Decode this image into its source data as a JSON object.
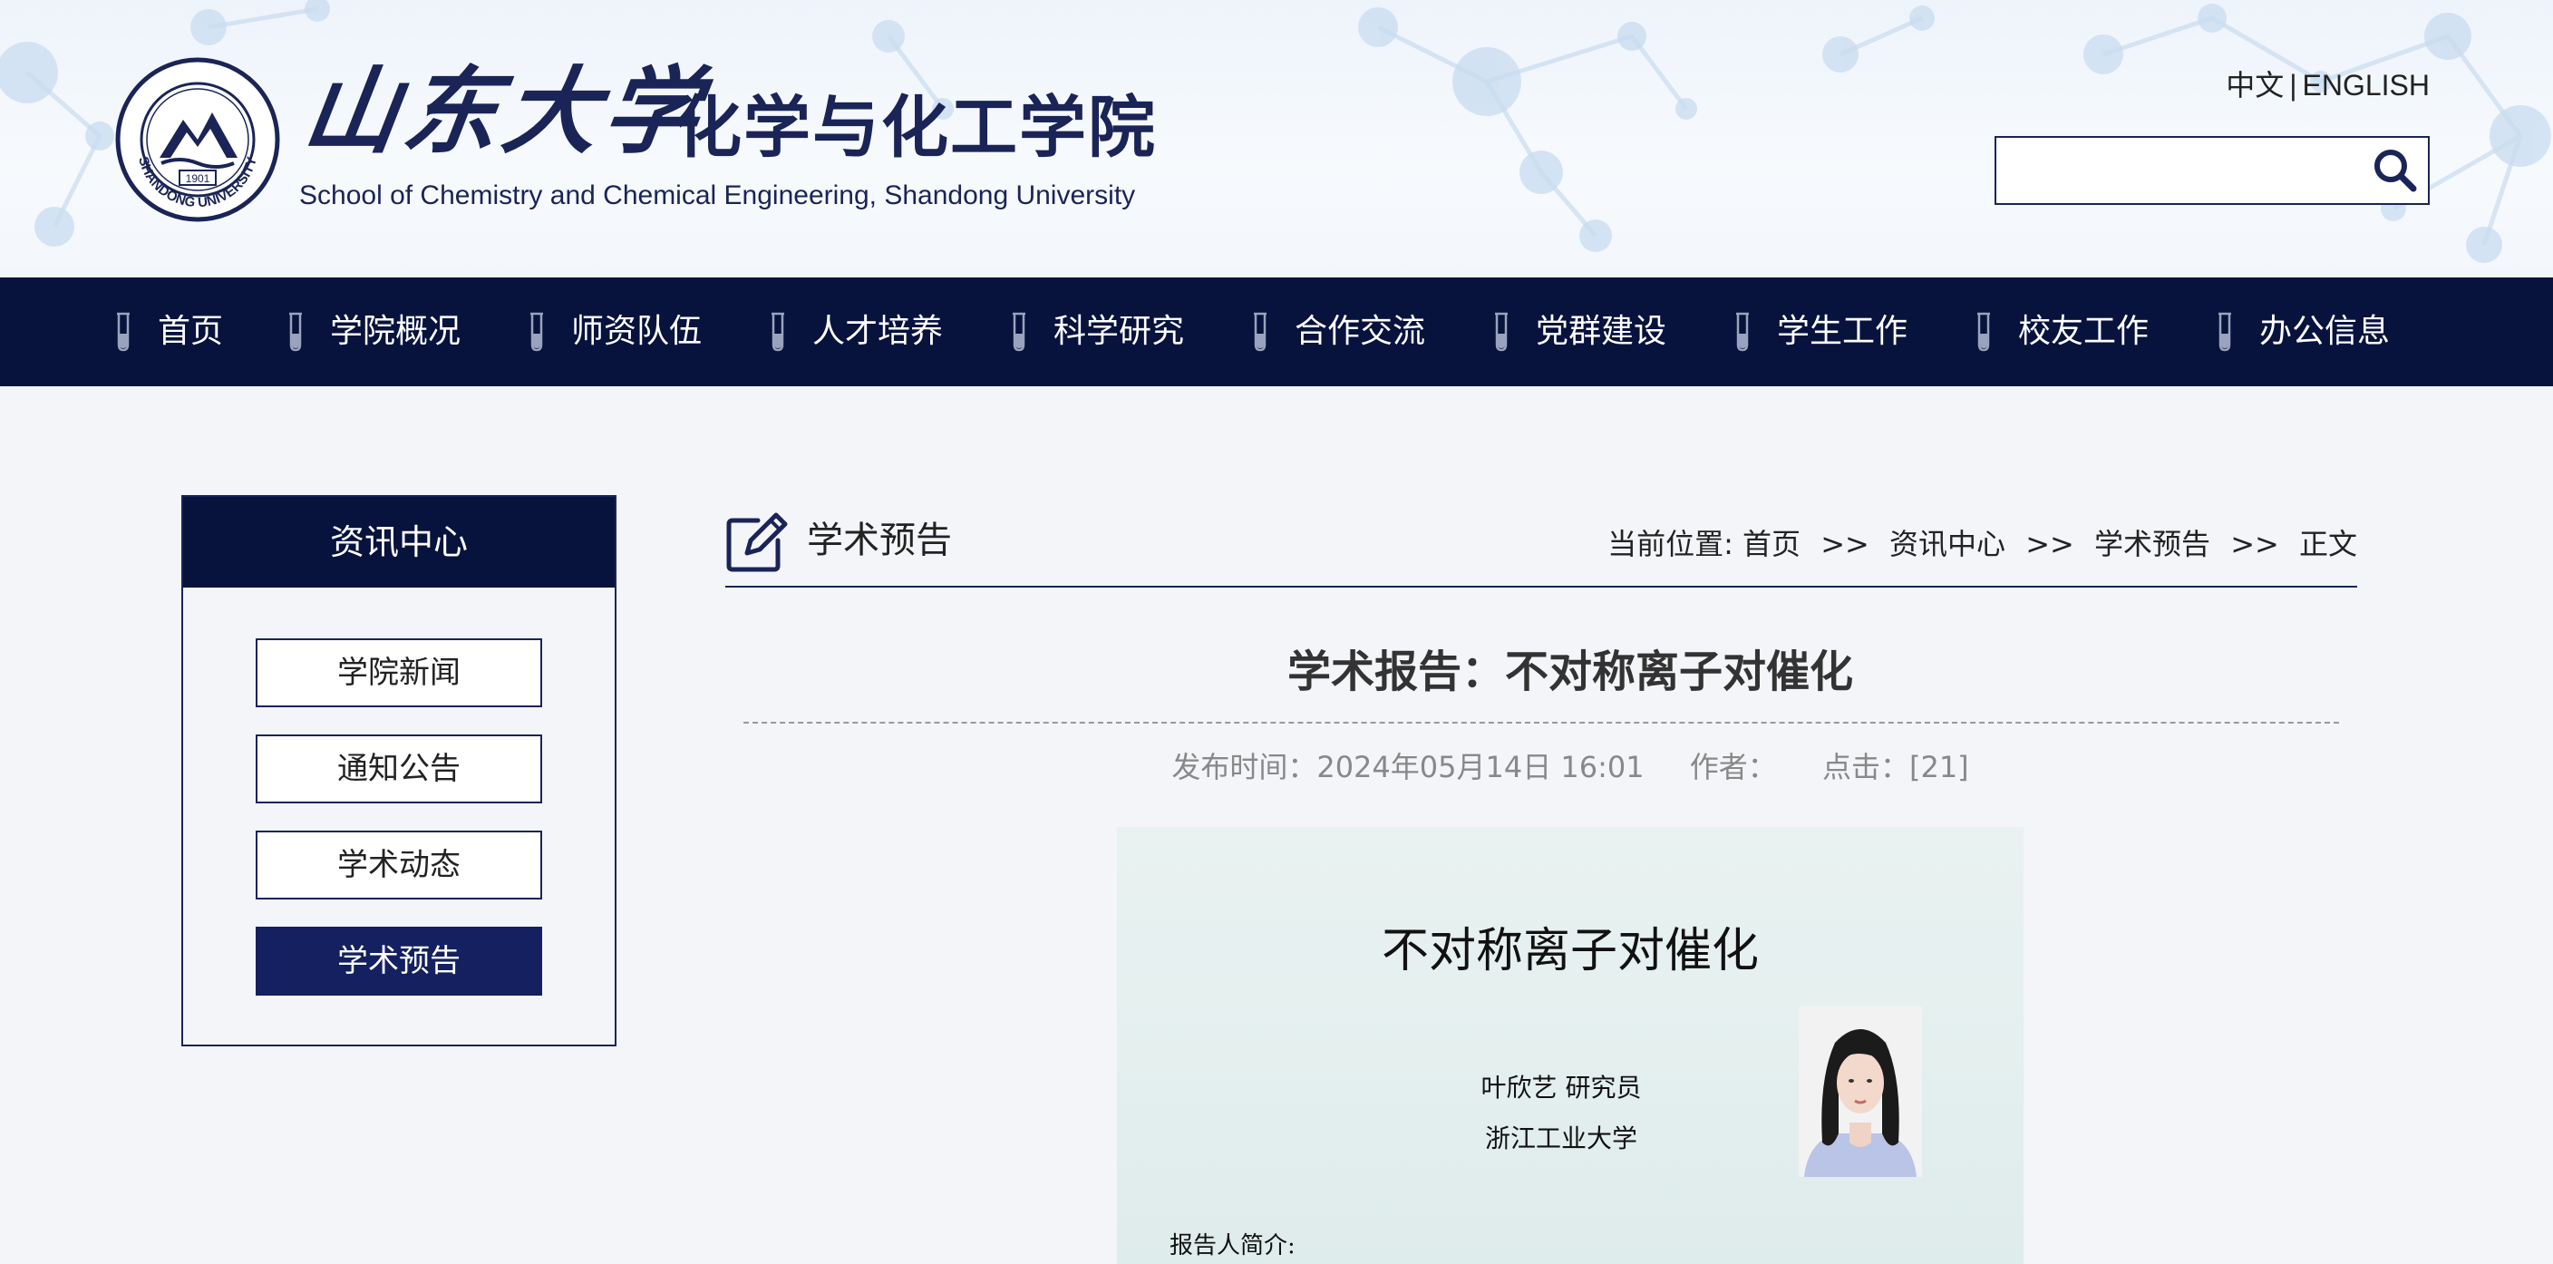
{
  "header": {
    "brand_calligraphy": "山东大学",
    "school_name_cn": "化学与化工学院",
    "school_name_en": "School of Chemistry and Chemical Engineering, Shandong University",
    "seal_text": "SHANDONG UNIVERSITY",
    "seal_year": "1901",
    "lang_cn": "中文",
    "lang_sep": "|",
    "lang_en": "ENGLISH",
    "search_placeholder": "",
    "search_value": ""
  },
  "nav": {
    "items": [
      {
        "label": "首页"
      },
      {
        "label": "学院概况"
      },
      {
        "label": "师资队伍"
      },
      {
        "label": "人才培养"
      },
      {
        "label": "科学研究"
      },
      {
        "label": "合作交流"
      },
      {
        "label": "党群建设"
      },
      {
        "label": "学生工作"
      },
      {
        "label": "校友工作"
      },
      {
        "label": "办公信息"
      }
    ]
  },
  "sidebar": {
    "title": "资讯中心",
    "items": [
      {
        "label": "学院新闻",
        "active": false
      },
      {
        "label": "通知公告",
        "active": false
      },
      {
        "label": "学术动态",
        "active": false
      },
      {
        "label": "学术预告",
        "active": true
      }
    ]
  },
  "section": {
    "title": "学术预告",
    "breadcrumb_prefix": "当前位置:",
    "breadcrumb": [
      "首页",
      "资讯中心",
      "学术预告",
      "正文"
    ],
    "breadcrumb_sep": ">>"
  },
  "article": {
    "title": "学术报告：不对称离子对催化",
    "publish_label": "发布时间：2024年05月14日 16:01",
    "author_label": "作者：",
    "clicks_label": "点击：[21]"
  },
  "poster": {
    "title": "不对称离子对催化",
    "speaker": "叶欣艺 研究员",
    "organization": "浙江工业大学",
    "bio_label": "报告人简介:"
  },
  "colors": {
    "navy": "#07123d",
    "brand_blue": "#1a2456",
    "active_blue": "#142060",
    "page_bg": "#f3f5f8"
  }
}
